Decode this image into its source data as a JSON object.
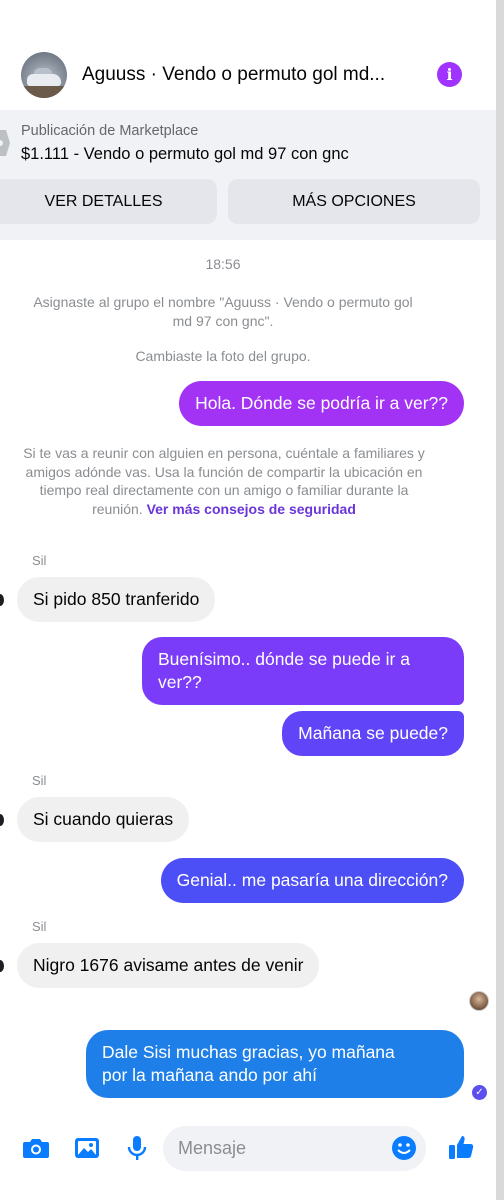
{
  "header": {
    "title": "Aguuss · Vendo o permuto gol md...",
    "info_glyph": "i"
  },
  "marketplace": {
    "label": "Publicación de Marketplace",
    "title": "$1.111 - Vendo o permuto gol md 97 con gnc",
    "details_button": "VER DETALLES",
    "options_button": "MÁS OPCIONES"
  },
  "chat": {
    "timestamp": "18:56",
    "system_rename": "Asignaste al grupo el nombre \"Aguuss · Vendo o permuto gol md 97 con gnc\".",
    "system_photo": "Cambiaste la foto del grupo.",
    "safety_text": "Si te vas a reunir con alguien en persona, cuéntale a familiares y amigos adónde vas. Usa la función de compartir la ubicación en tiempo real directamente con un amigo o familiar durante la reunión.",
    "safety_link": "Ver más consejos de seguridad",
    "messages": [
      {
        "dir": "out",
        "text": "Hola. Dónde se podría ir a ver??"
      },
      {
        "dir": "in",
        "sender": "Sil",
        "text": "Si pido 850 tranferido"
      },
      {
        "dir": "out",
        "text_line1": "Buenísimo.. dónde se puede ir a",
        "text_line2": "ver??"
      },
      {
        "dir": "out",
        "text": "Mañana se puede?"
      },
      {
        "dir": "in",
        "sender": "Sil",
        "text": "Si cuando quieras"
      },
      {
        "dir": "out",
        "text": "Genial.. me pasaría una dirección?"
      },
      {
        "dir": "in",
        "sender": "Sil",
        "text": "Nigro 1676 avisame antes de venir"
      },
      {
        "dir": "out",
        "text_line1": "Dale Sisi muchas gracias, yo mañana",
        "text_line2": "por la mañana ando por ahí"
      }
    ]
  },
  "composer": {
    "placeholder": "Mensaje",
    "icons": [
      "camera-icon",
      "gallery-icon",
      "microphone-icon",
      "emoji-icon",
      "thumbs-up-icon"
    ]
  },
  "colors": {
    "accent_purple": "#a033ff",
    "accent_blue": "#1f7fe8",
    "link_purple": "#6a35d9"
  }
}
